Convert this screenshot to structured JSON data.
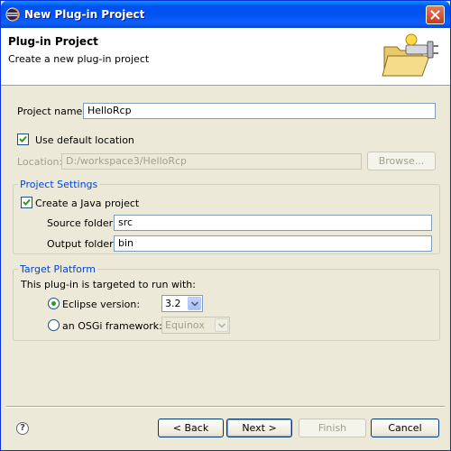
{
  "window": {
    "title": "New Plug-in Project"
  },
  "banner": {
    "title": "Plug-in Project",
    "description": "Create a new plug-in project"
  },
  "project_name": {
    "label": "Project name:",
    "value": "HelloRcp"
  },
  "use_default_location": {
    "label": "Use default location",
    "checked": true
  },
  "location": {
    "label": "Location:",
    "value": "D:/workspace3/HelloRcp",
    "browse_label": "Browse..."
  },
  "project_settings": {
    "title": "Project Settings",
    "create_java_label": "Create a Java project",
    "create_java_checked": true,
    "source_folder_label": "Source folder:",
    "source_folder_value": "src",
    "output_folder_label": "Output folder:",
    "output_folder_value": "bin"
  },
  "target_platform": {
    "title": "Target Platform",
    "description": "This plug-in is targeted to run with:",
    "eclipse_version_label": "Eclipse version:",
    "eclipse_version_value": "3.2",
    "eclipse_selected": true,
    "osgi_label": "an OSGi framework:",
    "osgi_value": "Equinox"
  },
  "buttons": {
    "help": "?",
    "back": "< Back",
    "next": "Next >",
    "finish": "Finish",
    "cancel": "Cancel"
  },
  "colors": {
    "title_bar": "#0053ee",
    "group_title": "#0046d5",
    "background": "#ece9d8"
  }
}
